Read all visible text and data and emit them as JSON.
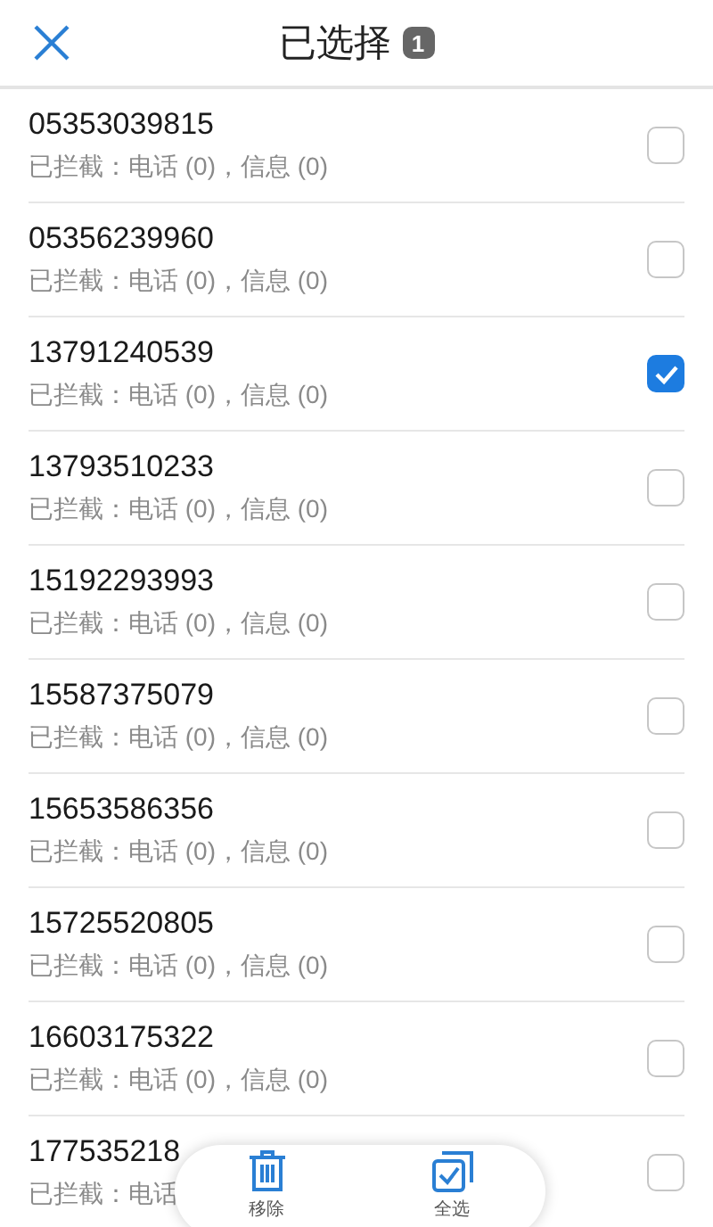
{
  "header": {
    "title": "已选择",
    "count": "1"
  },
  "rows": [
    {
      "number": "05353039815",
      "detail": "已拦截：电话 (0)，信息 (0)",
      "checked": false
    },
    {
      "number": "05356239960",
      "detail": "已拦截：电话 (0)，信息 (0)",
      "checked": false
    },
    {
      "number": "13791240539",
      "detail": "已拦截：电话 (0)，信息 (0)",
      "checked": true
    },
    {
      "number": "13793510233",
      "detail": "已拦截：电话 (0)，信息 (0)",
      "checked": false
    },
    {
      "number": "15192293993",
      "detail": "已拦截：电话 (0)，信息 (0)",
      "checked": false
    },
    {
      "number": "15587375079",
      "detail": "已拦截：电话 (0)，信息 (0)",
      "checked": false
    },
    {
      "number": "15653586356",
      "detail": "已拦截：电话 (0)，信息 (0)",
      "checked": false
    },
    {
      "number": "15725520805",
      "detail": "已拦截：电话 (0)，信息 (0)",
      "checked": false
    },
    {
      "number": "16603175322",
      "detail": "已拦截：电话 (0)，信息 (0)",
      "checked": false
    },
    {
      "number": "177535218",
      "detail": "已拦截：电话",
      "checked": false
    }
  ],
  "actions": [
    {
      "kind": "delete",
      "label": "移除"
    },
    {
      "kind": "select_all",
      "label": "全选"
    }
  ]
}
